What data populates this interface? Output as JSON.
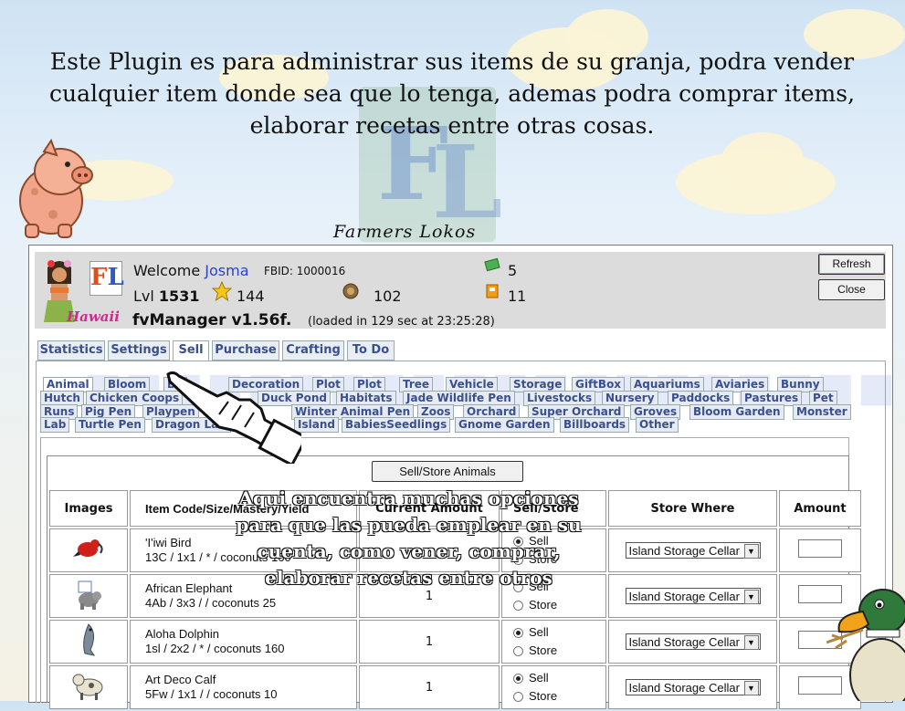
{
  "banner": {
    "text": "Este Plugin es para  administrar sus items de su granja, podra vender cualquier item donde  sea que lo tenga, ademas podra comprar items, elaborar recetas entre otras cosas.",
    "signature": "Farmers Lokos"
  },
  "header": {
    "welcome_prefix": "Welcome",
    "user_name": "Josma",
    "fbid": "FBID: 1000016",
    "lvl_label": "Lvl",
    "level": "1531",
    "stars": "144",
    "coins": "102",
    "cash": "5",
    "fuel": "11",
    "badge_text": "Hawaii",
    "app_title": "fvManager v1.56f.",
    "loaded_text": "(loaded in 129 sec at 23:25:28)",
    "refresh_label": "Refresh",
    "close_label": "Close"
  },
  "main_tabs": [
    "Statistics",
    "Settings",
    "Sell",
    "Purchase",
    "Crafting",
    "To Do"
  ],
  "active_main_tab": "Sell",
  "sub_tabs": {
    "row1": [
      "Animal",
      "Bloom",
      "Bu",
      "Decoration",
      "Plot",
      "Plot",
      "Tree",
      "Vehicle",
      "Storage",
      "GiftBox",
      "Aquariums",
      "Aviaries",
      "Bunny"
    ],
    "row2": [
      "Hutch",
      "Chicken Coops",
      "Duck Pond",
      "Habitats",
      "Jade Wildlife Pen",
      "Livestocks",
      "Nursery",
      "Paddocks",
      "Pastures",
      "Pet"
    ],
    "row3": [
      "Runs",
      "Pig Pen",
      "Playpen",
      "Winter Animal Pen",
      "Zoos",
      "Orchard",
      "Super Orchard",
      "Groves",
      "Bloom Garden",
      "Monster"
    ],
    "row4": [
      "Lab",
      "Turtle Pen",
      "Dragon Lair",
      "Island",
      "BabiesSeedlings",
      "Gnome Garden",
      "Billboards",
      "Other"
    ]
  },
  "sell_button_label": "Sell/Store Animals",
  "table": {
    "headers": [
      "Images",
      "Item Code/Size/Mastery/Yield",
      "Current Amount",
      "Sell/Store",
      "Store Where",
      "Amount"
    ],
    "rows": [
      {
        "name": "'I'iwi Bird",
        "details": "13C / 1x1 / * / coconuts 160",
        "amount": "",
        "sell": "Sell",
        "store": "Store",
        "sell_selected": true,
        "store_where": "Island Storage Cellar",
        "icon": "red-bird-icon"
      },
      {
        "name": "African Elephant",
        "details": "4Ab / 3x3 /   / coconuts 25",
        "amount": "1",
        "sell": "Sell",
        "store": "Store",
        "sell_selected": false,
        "store_where": "Island Storage Cellar",
        "icon": "elephant-icon"
      },
      {
        "name": "Aloha Dolphin",
        "details": "1sl / 2x2 / * / coconuts 160",
        "amount": "1",
        "sell": "Sell",
        "store": "Store",
        "sell_selected": true,
        "store_where": "Island Storage Cellar",
        "icon": "dolphin-icon"
      },
      {
        "name": "Art Deco Calf",
        "details": "5Fw / 1x1 /   / coconuts 10",
        "amount": "1",
        "sell": "Sell",
        "store": "Store",
        "sell_selected": true,
        "store_where": "Island Storage Cellar",
        "icon": "calf-icon"
      }
    ]
  },
  "overlay_text": "Aqui encuentra muchas opciones para que las pueda emplear en su cuenta, como vener, comprar, elaborar recetas  entre otros"
}
